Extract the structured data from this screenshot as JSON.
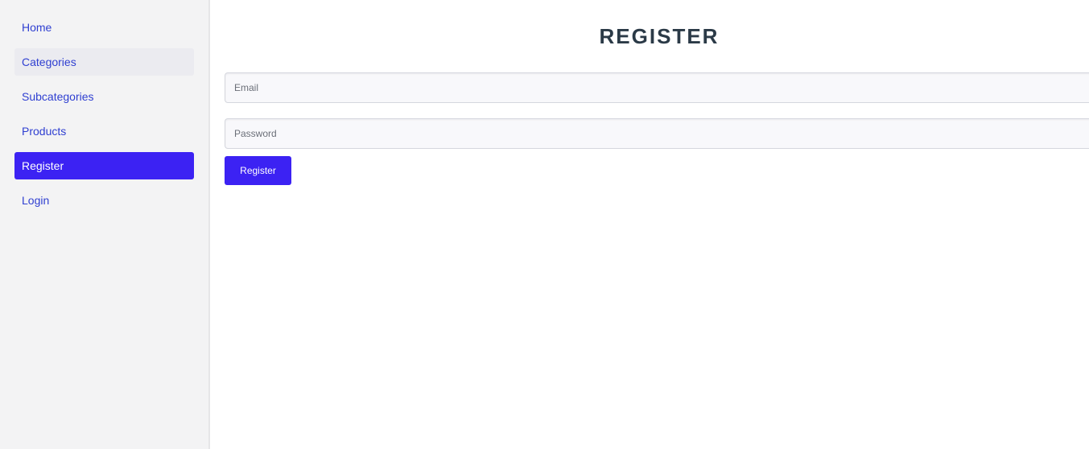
{
  "sidebar": {
    "items": [
      {
        "label": "Home"
      },
      {
        "label": "Categories"
      },
      {
        "label": "Subcategories"
      },
      {
        "label": "Products"
      },
      {
        "label": "Register"
      },
      {
        "label": "Login"
      }
    ],
    "active_item": "Register",
    "hover_item": "Categories"
  },
  "main": {
    "title": "REGISTER",
    "email": {
      "placeholder": "Email",
      "value": ""
    },
    "password": {
      "placeholder": "Password",
      "value": ""
    },
    "submit_label": "Register"
  },
  "colors": {
    "accent": "#3c22f3",
    "link": "#2f3fd1",
    "title": "#2b3a47",
    "sidebar_bg": "#f3f3f4"
  }
}
